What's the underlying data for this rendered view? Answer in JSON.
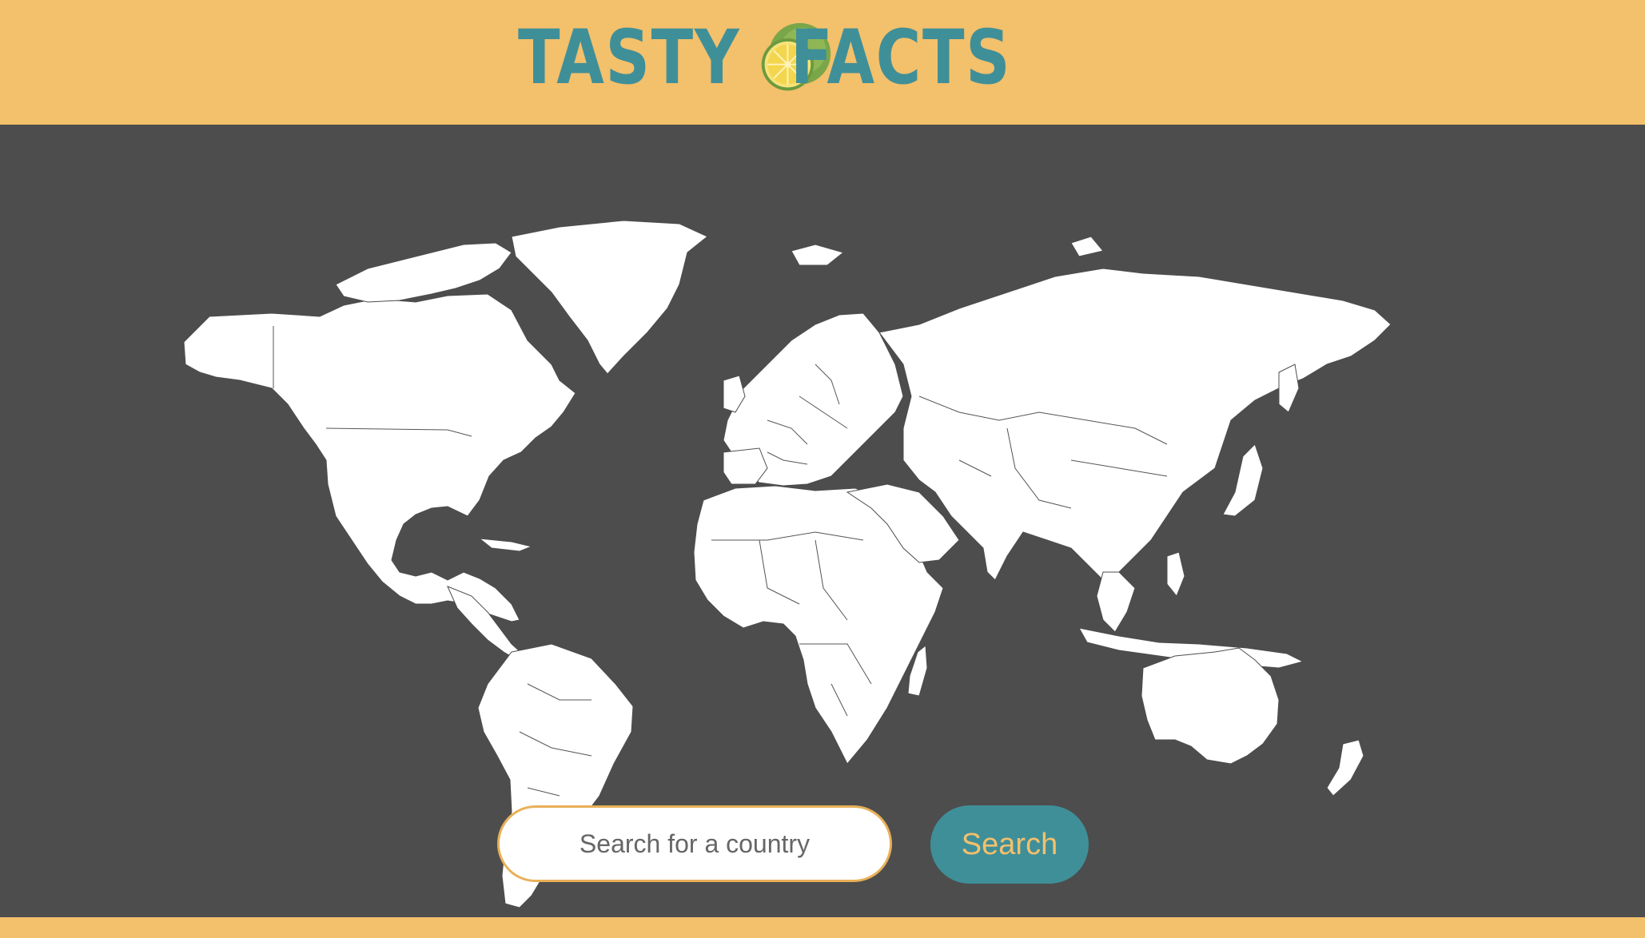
{
  "header": {
    "logo_word_1": "Tasty",
    "logo_word_2": "Facts",
    "logo_icon": "lime-icon"
  },
  "map": {
    "icon": "world-map"
  },
  "search": {
    "placeholder": "Search for a country",
    "button_label": "Search"
  },
  "colors": {
    "header_bg": "#f3c06b",
    "page_bg": "#4d4d4d",
    "brand_teal": "#3f8f99",
    "land": "#ffffff"
  }
}
